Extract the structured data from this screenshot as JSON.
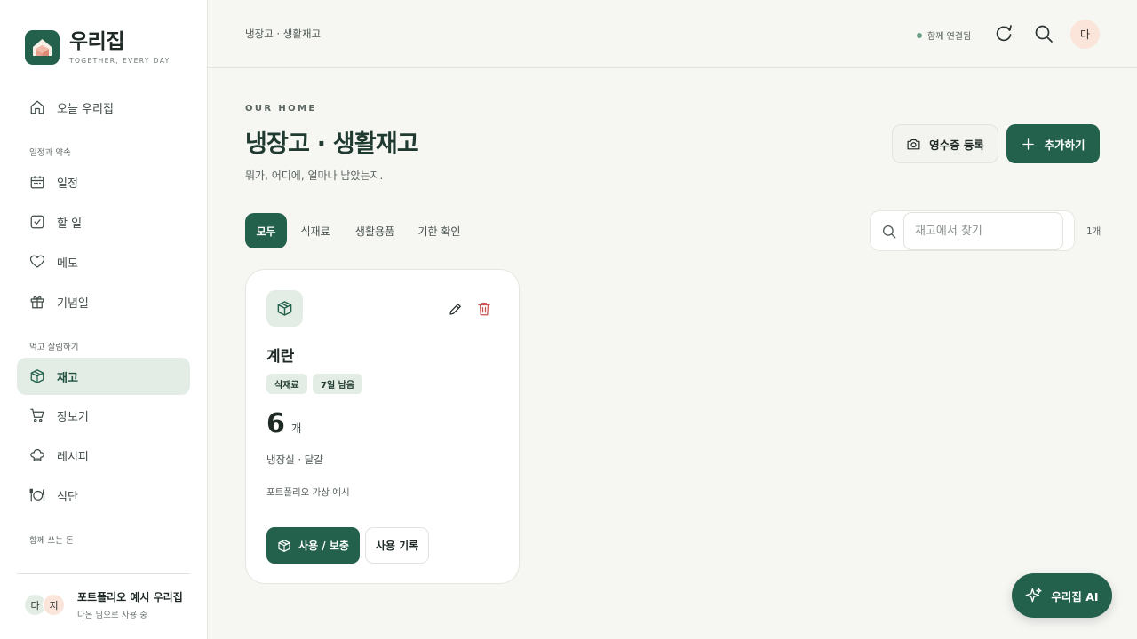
{
  "brand": {
    "name": "우리집",
    "tagline": "TOGETHER, EVERY DAY"
  },
  "sidebar": {
    "today": {
      "label": "오늘 우리집",
      "icon": "home-icon"
    },
    "section1": "일정과 약속",
    "schedule": {
      "label": "일정",
      "icon": "calendar-icon"
    },
    "todo": {
      "label": "할 일",
      "icon": "checkbox-icon"
    },
    "memo": {
      "label": "메모",
      "icon": "heart-icon"
    },
    "anniversary": {
      "label": "기념일",
      "icon": "gift-icon"
    },
    "section2": "먹고 살림하기",
    "inventory": {
      "label": "재고",
      "icon": "box-icon"
    },
    "shopping": {
      "label": "장보기",
      "icon": "cart-icon"
    },
    "recipe": {
      "label": "레시피",
      "icon": "chef-hat-icon"
    },
    "meal": {
      "label": "식단",
      "icon": "plate-icon"
    },
    "section3": "함께 쓰는 돈",
    "user": {
      "avatar1": "다",
      "avatar2": "지",
      "name": "포트폴리오 예시 우리집",
      "sub": "다온 님으로 사용 중"
    }
  },
  "topbar": {
    "breadcrumb": "냉장고 · 생활재고",
    "status": "함께 연결됨",
    "avatar": "다"
  },
  "page": {
    "eyebrow": "OUR HOME",
    "title": "냉장고 · 생활재고",
    "subtitle": "뭐가, 어디에, 얼마나 남았는지.",
    "receipt_button": "영수증 등록",
    "add_button": "추가하기"
  },
  "filters": {
    "tabs": [
      "모두",
      "식재료",
      "생활용품",
      "기한 확인"
    ],
    "active": "모두"
  },
  "search": {
    "placeholder": "재고에서 찾기",
    "value": "",
    "count": "1개"
  },
  "items": [
    {
      "name": "계란",
      "category": "식재료",
      "expiry": "7일 남음",
      "quantity": "6",
      "unit": "개",
      "location": "냉장실 · 달걀",
      "note": "포트폴리오 가상 예시",
      "use_button": "사용 / 보충",
      "log_button": "사용 기록"
    }
  ],
  "assistant": {
    "label": "우리집 AI"
  },
  "colors": {
    "primary": "#24614d",
    "active_bg": "#e3ede5",
    "danger": "#c9524f",
    "peach": "#fbe4da",
    "background": "#f6f6f3"
  }
}
